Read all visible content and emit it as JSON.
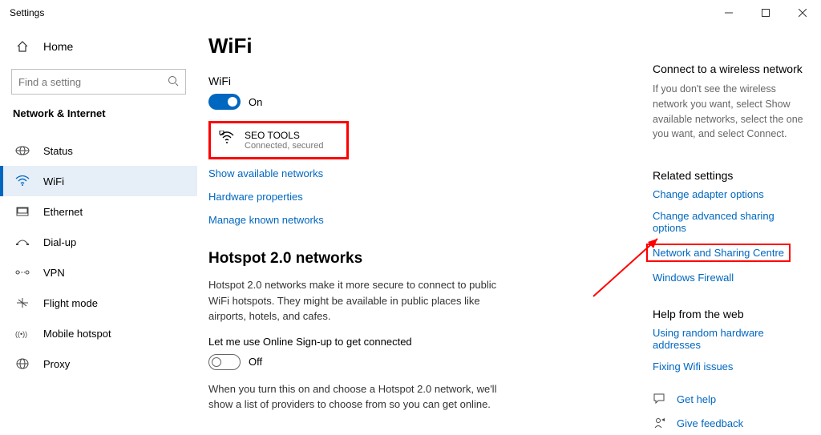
{
  "window": {
    "title": "Settings"
  },
  "sidebar": {
    "home_label": "Home",
    "search_placeholder": "Find a setting",
    "category_label": "Network & Internet",
    "items": [
      {
        "label": "Status"
      },
      {
        "label": "WiFi"
      },
      {
        "label": "Ethernet"
      },
      {
        "label": "Dial-up"
      },
      {
        "label": "VPN"
      },
      {
        "label": "Flight mode"
      },
      {
        "label": "Mobile hotspot"
      },
      {
        "label": "Proxy"
      }
    ]
  },
  "main": {
    "title": "WiFi",
    "wifi_label": "WiFi",
    "wifi_toggle_state": "On",
    "connected_network": {
      "name": "SEO TOOLS",
      "status": "Connected, secured"
    },
    "links": {
      "show_networks": "Show available networks",
      "hardware_props": "Hardware properties",
      "manage_known": "Manage known networks"
    },
    "hotspot": {
      "title": "Hotspot 2.0 networks",
      "desc": "Hotspot 2.0 networks make it more secure to connect to public WiFi hotspots. They might be available in public places like airports, hotels, and cafes.",
      "signup_label": "Let me use Online Sign-up to get connected",
      "signup_toggle_state": "Off",
      "desc2": "When you turn this on and choose a Hotspot 2.0 network, we'll show a list of providers to choose from so you can get online."
    }
  },
  "aside": {
    "connect_head": "Connect to a wireless network",
    "connect_desc": "If you don't see the wireless network you want, select Show available networks, select the one you want, and select Connect.",
    "related_head": "Related settings",
    "related_links": {
      "adapter": "Change adapter options",
      "sharing": "Change advanced sharing options",
      "nsc": "Network and Sharing Centre",
      "firewall": "Windows Firewall"
    },
    "help_head": "Help from the web",
    "help_links": {
      "mac": "Using random hardware addresses",
      "wifi": "Fixing Wifi issues"
    },
    "get_help": "Get help",
    "feedback": "Give feedback"
  }
}
